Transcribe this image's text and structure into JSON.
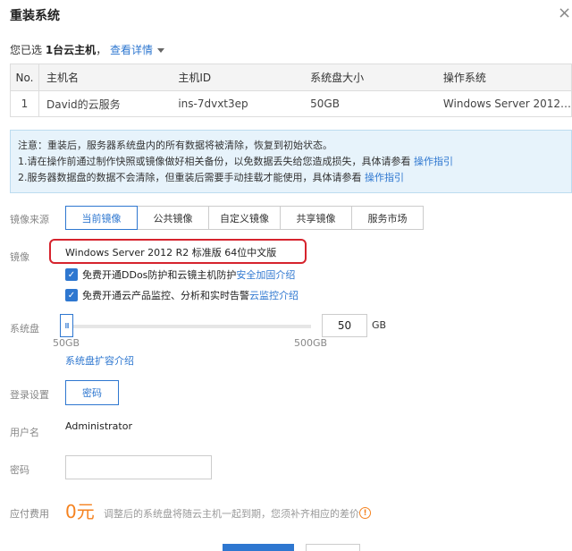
{
  "dialog": {
    "title": "重装系统",
    "close": "×"
  },
  "selection": {
    "prefix": "您已选 ",
    "count": "1台云主机",
    "suffix": "，",
    "details_link": "查看详情"
  },
  "table": {
    "headers": [
      "No.",
      "主机名",
      "主机ID",
      "系统盘大小",
      "操作系统"
    ],
    "rows": [
      [
        "1",
        "David的云服务",
        "ins-7dvxt3ep",
        "50GB",
        "Windows Server 2012…"
      ]
    ]
  },
  "notice": {
    "line1": "注意：重装后，服务器系统盘内的所有数据将被清除，恢复到初始状态。",
    "line2_text": "1.请在操作前通过制作快照或镜像做好相关备份，以免数据丢失给您造成损失，具体请参看 ",
    "line2_link": "操作指引",
    "line3_text": "2.服务器数据盘的数据不会清除，但重装后需要手动挂载才能使用，具体请参看 ",
    "line3_link": "操作指引"
  },
  "image_source": {
    "label": "镜像来源",
    "tabs": [
      "当前镜像",
      "公共镜像",
      "自定义镜像",
      "共享镜像",
      "服务市场"
    ],
    "active": "当前镜像"
  },
  "image": {
    "label": "镜像",
    "name": "Windows Server 2012 R2 标准版 64位中文版"
  },
  "options": [
    {
      "text": "免费开通DDos防护和云镜主机防护 ",
      "link": "安全加固介绍",
      "checked": true
    },
    {
      "text": "免费开通云产品监控、分析和实时告警 ",
      "link": "云监控介绍",
      "checked": true
    }
  ],
  "system_disk": {
    "label": "系统盘",
    "min_label": "50GB",
    "max_label": "500GB",
    "value": "50",
    "unit": "GB",
    "fill_fraction": 0,
    "expand_link": "系统盘扩容介绍",
    "handle_glyph": "III"
  },
  "login": {
    "label": "登录设置",
    "button": "密码"
  },
  "username": {
    "label": "用户名",
    "value": "Administrator"
  },
  "password": {
    "label": "密码",
    "value": ""
  },
  "fee": {
    "label": "应付费用",
    "amount": "0元",
    "note": "调整后的系统盘将随云主机一起到期，您须补齐相应的差价",
    "icon": "!"
  },
  "colors": {
    "accent": "#2e77d0",
    "price": "#f5821f",
    "highlight": "#d6232d",
    "notice_bg": "#e7f3fb"
  }
}
